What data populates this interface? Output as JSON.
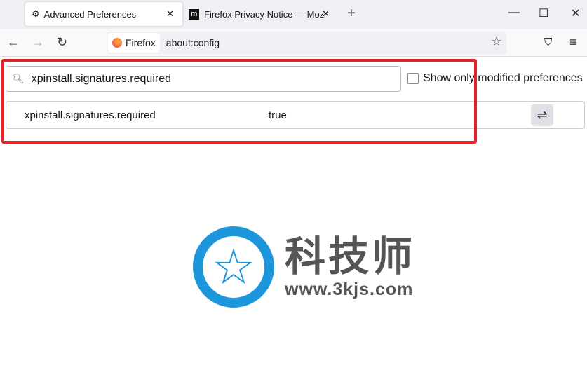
{
  "tabs": [
    {
      "label": "Advanced Preferences",
      "icon": "gear-icon",
      "active": true
    },
    {
      "label": "Firefox Privacy Notice — Moz",
      "icon": "mozilla-icon",
      "active": false
    }
  ],
  "toolbar": {
    "identity": "Firefox",
    "url": "about:config"
  },
  "config": {
    "search_value": "xpinstall.signatures.required",
    "show_modified_label": "Show only modified preferences",
    "show_modified_checked": false,
    "rows": [
      {
        "name": "xpinstall.signatures.required",
        "value": "true"
      }
    ]
  },
  "watermark": {
    "cn": "科技师",
    "url": "www.3kjs.com"
  },
  "colors": {
    "highlight": "#e3242b",
    "watermark_blue": "#1e96dc"
  }
}
